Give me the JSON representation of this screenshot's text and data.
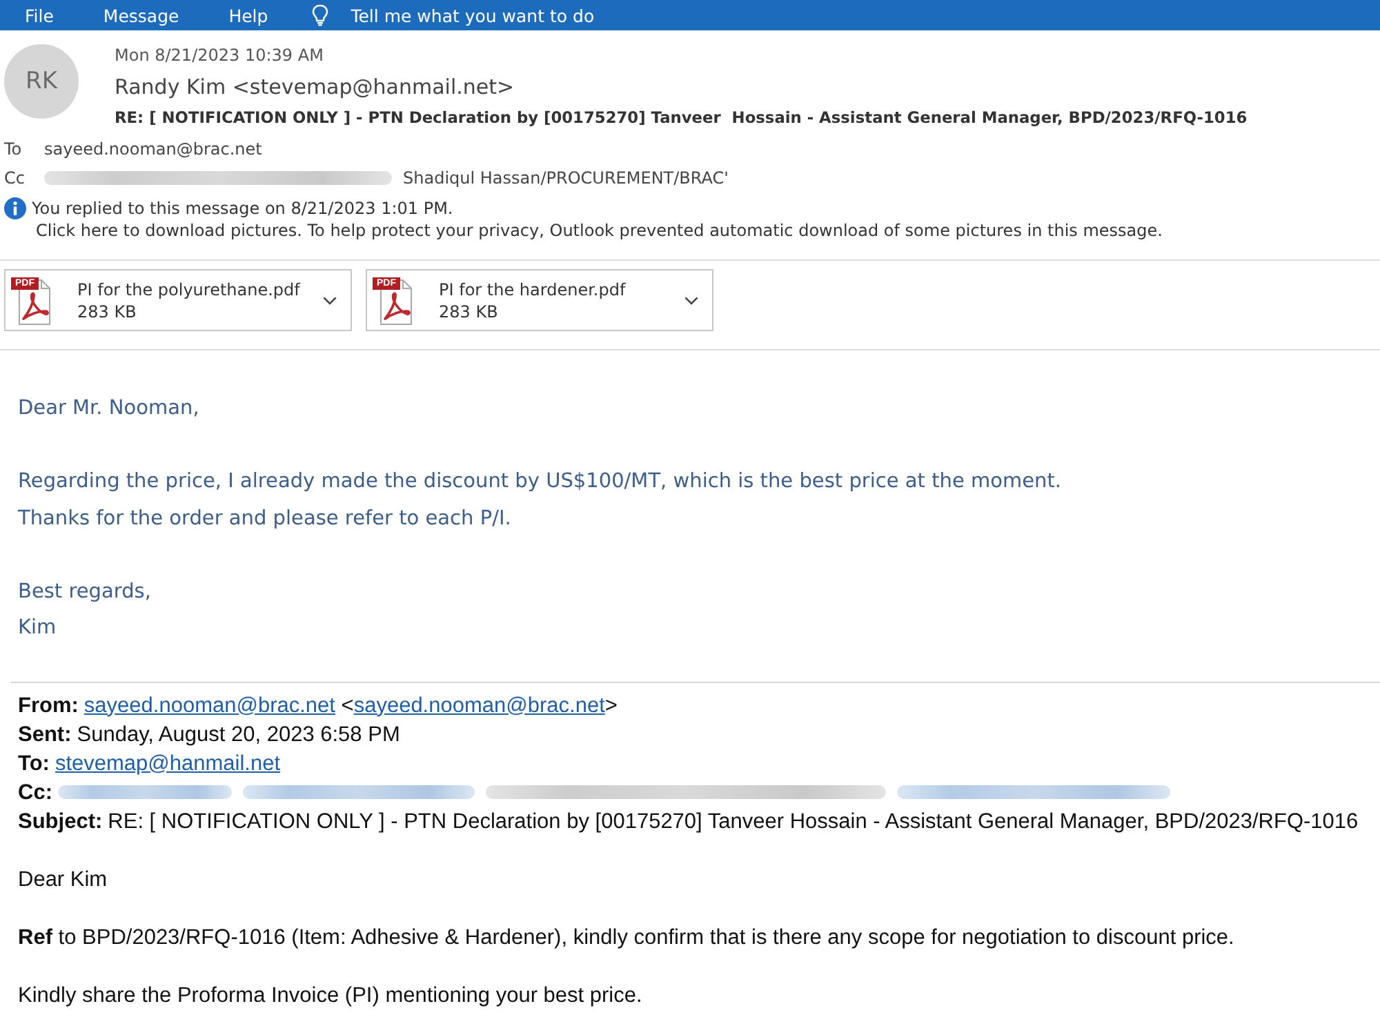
{
  "menu_bar": {
    "items": [
      {
        "label": "File"
      },
      {
        "label": "Message"
      },
      {
        "label": "Help"
      }
    ],
    "tell_me": "Tell me what you want to do"
  },
  "message_header": {
    "avatar_initials": "RK",
    "date": "Mon 8/21/2023 10:39 AM",
    "sender": "Randy Kim <stevemap@hanmail.net>",
    "subject": "RE: [ NOTIFICATION ONLY ] - PTN Declaration by [00175270] Tanveer  Hossain - Assistant General Manager, BPD/2023/RFQ-1016",
    "recipients": [
      {
        "label": "To",
        "parts": [
          {
            "kind": "text",
            "text": "sayeed.nooman@brac.net"
          }
        ]
      },
      {
        "label": "Cc",
        "parts": [
          {
            "kind": "blurred"
          },
          {
            "kind": "text",
            "text": "Shadiqul Hassan/PROCUREMENT/BRAC'"
          }
        ]
      }
    ],
    "info_lines": [
      "You replied to this message on 8/21/2023 1:01 PM.",
      "Click here to download pictures. To help protect your privacy, Outlook prevented automatic download of some pictures in this message."
    ]
  },
  "attachments": [
    {
      "badge": "PDF",
      "name": "PI for the polyurethane.pdf",
      "size": "283 KB"
    },
    {
      "badge": "PDF",
      "name": "PI for the hardener.pdf",
      "size": "283 KB"
    }
  ],
  "body": {
    "paragraphs": [
      [
        "Dear Mr. Nooman,"
      ],
      [
        "Regarding the price, I already made the discount by US$100/MT, which is the best price at the moment.",
        "Thanks for the order and please refer to each P/I."
      ],
      [
        "Best regards,",
        "Kim"
      ]
    ]
  },
  "quoted_message": {
    "header_lines": [
      {
        "label": "From:",
        "parts": [
          {
            "kind": "link",
            "text": "sayeed.nooman@brac.net"
          },
          {
            "kind": "text",
            "text": " <"
          },
          {
            "kind": "link",
            "text": "sayeed.nooman@brac.net"
          },
          {
            "kind": "text",
            "text": ">"
          }
        ]
      },
      {
        "label": "Sent:",
        "parts": [
          {
            "kind": "text",
            "text": "Sunday, August 20, 2023 6:58 PM"
          }
        ]
      },
      {
        "label": "To:",
        "parts": [
          {
            "kind": "link",
            "text": "stevemap@hanmail.net"
          }
        ]
      },
      {
        "label": "Cc:",
        "parts": [
          {
            "kind": "blurredlink"
          },
          {
            "kind": "blurredlink"
          },
          {
            "kind": "blurred"
          },
          {
            "kind": "blurredlink"
          }
        ]
      },
      {
        "label": "Subject:",
        "parts": [
          {
            "kind": "text",
            "text": "RE: [ NOTIFICATION ONLY ] - PTN Declaration by [00175270] Tanveer Hossain - Assistant General Manager, BPD/2023/RFQ-1016"
          }
        ]
      }
    ],
    "paragraphs": [
      "Dear Kim",
      "**Ref** to BPD/2023/RFQ-1016 (Item: Adhesive & Hardener), kindly confirm that is there any scope for negotiation to discount price.",
      "Kindly share the Proforma Invoice (PI) mentioning your best price."
    ]
  }
}
